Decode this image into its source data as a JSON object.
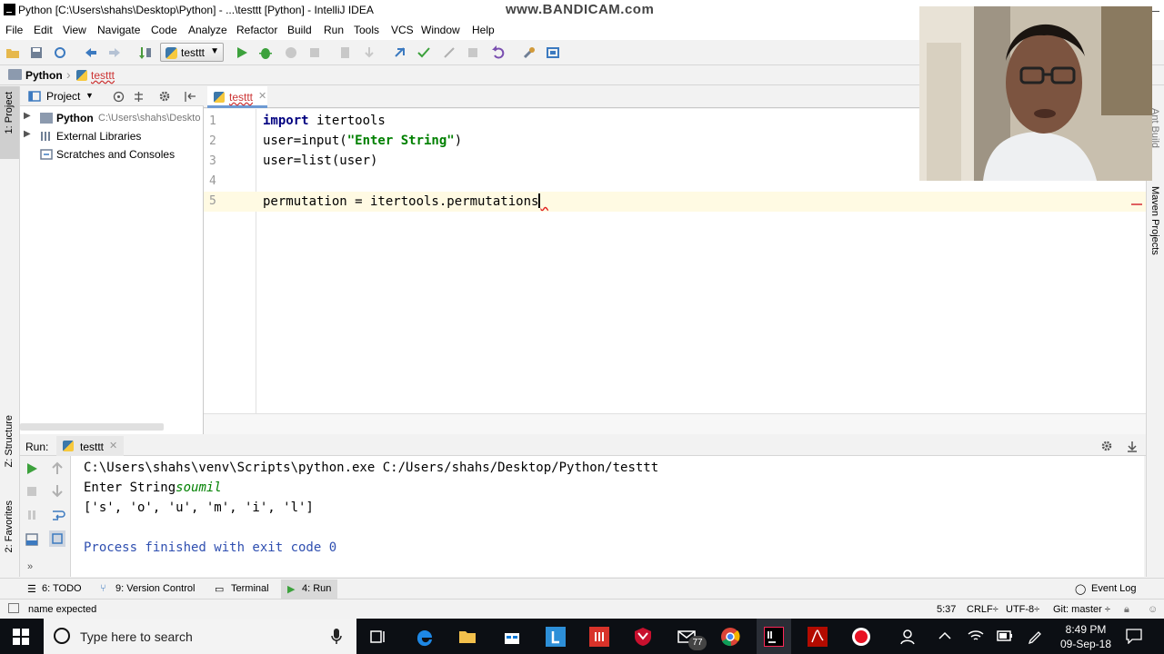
{
  "window": {
    "title": "Python [C:\\Users\\shahs\\Desktop\\Python] - ...\\testtt [Python] - IntelliJ IDEA",
    "watermark": "www.BANDICAM.com"
  },
  "menu": [
    "File",
    "Edit",
    "View",
    "Navigate",
    "Code",
    "Analyze",
    "Refactor",
    "Build",
    "Run",
    "Tools",
    "VCS",
    "Window",
    "Help"
  ],
  "toolbar": {
    "run_config": "testtt"
  },
  "navbar": {
    "project": "Python",
    "file": "testtt"
  },
  "left_strip": {
    "project_tab": "1: Project",
    "structure_tab": "Z: Structure",
    "favorites_tab": "2: Favorites"
  },
  "right_strip": {
    "ant_tab": "Ant Build",
    "maven_tab": "Maven Projects"
  },
  "project_panel": {
    "title": "Project",
    "items": [
      {
        "name": "Python",
        "path": "C:\\Users\\shahs\\Deskto"
      },
      {
        "name": "External Libraries",
        "path": ""
      },
      {
        "name": "Scratches and Consoles",
        "path": ""
      }
    ]
  },
  "editor": {
    "tab": "testtt",
    "line_numbers": [
      "1",
      "2",
      "3",
      "4",
      "5"
    ],
    "lines": {
      "l1_kw": "import",
      "l1_rest": " itertools",
      "l2_a": "user=input(",
      "l2_str": "\"Enter String\"",
      "l2_b": ")",
      "l3": "user=list(user)",
      "l5": "permutation = itertools.permutations"
    }
  },
  "run_panel": {
    "label": "Run:",
    "tab": "testtt",
    "console": {
      "cmd": "C:\\Users\\shahs\\venv\\Scripts\\python.exe C:/Users/shahs/Desktop/Python/testtt",
      "prompt": "Enter String",
      "input": "soumil",
      "output": "['s', 'o', 'u', 'm', 'i', 'l']",
      "exit": "Process finished with exit code 0"
    }
  },
  "tool_tabs": {
    "todo": "6: TODO",
    "vcs": "9: Version Control",
    "terminal": "Terminal",
    "run": "4: Run",
    "event_log": "Event Log"
  },
  "status_bar": {
    "message": "name expected",
    "position": "5:37",
    "line_sep": "CRLF÷",
    "encoding": "UTF-8÷",
    "git": "Git: master ÷"
  },
  "taskbar": {
    "search_placeholder": "Type here to search",
    "time": "8:49 PM",
    "date": "09-Sep-18",
    "mail_badge": "77"
  }
}
